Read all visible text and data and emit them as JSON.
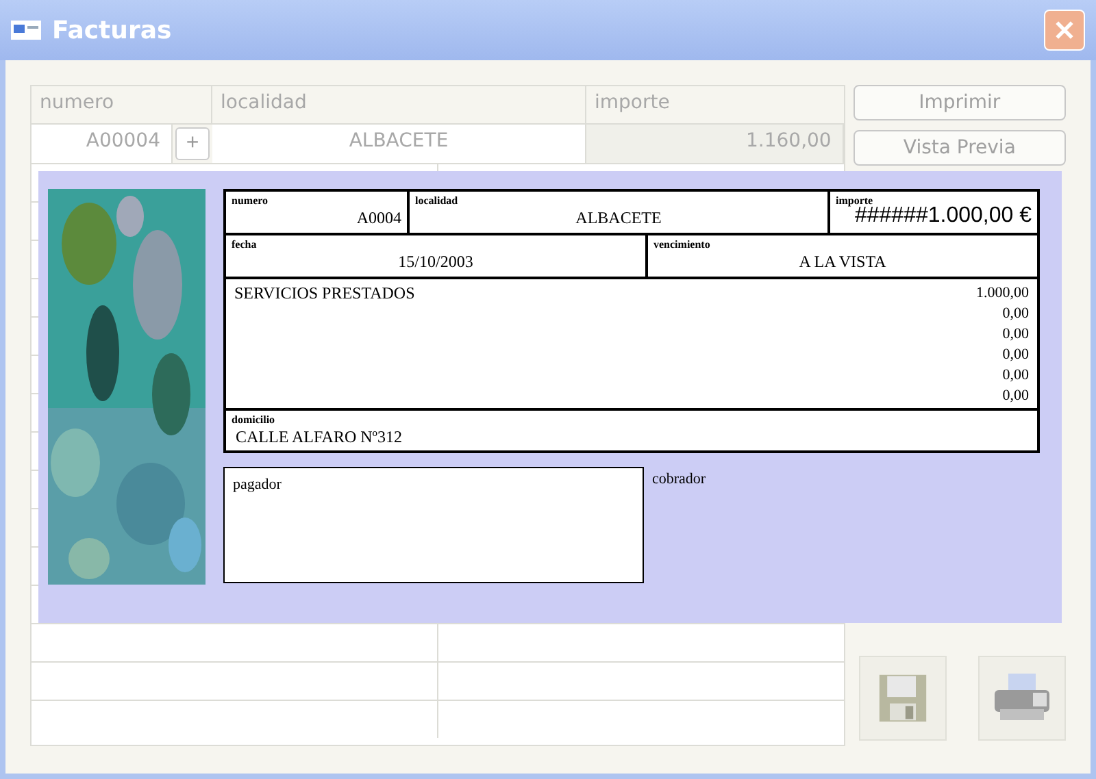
{
  "window": {
    "title": "Facturas"
  },
  "form": {
    "columns": [
      "numero",
      "localidad",
      "importe"
    ],
    "numero": "A00004",
    "add_button": "+",
    "localidad": "ALBACETE",
    "importe": "1.160,00"
  },
  "buttons": [
    "Imprimir",
    "Vista Previa"
  ],
  "preview": {
    "numero": {
      "label": "numero",
      "value": "A0004"
    },
    "localidad": {
      "label": "localidad",
      "value": "ALBACETE"
    },
    "importe": {
      "label": "importe",
      "value": "######1.000,00 €"
    },
    "fecha": {
      "label": "fecha",
      "value": "15/10/2003"
    },
    "vencimiento": {
      "label": "vencimiento",
      "value": "A LA VISTA"
    },
    "concepto": "SERVICIOS PRESTADOS",
    "amounts": [
      "1.000,00",
      "0,00",
      "0,00",
      "0,00",
      "0,00",
      "0,00"
    ],
    "domicilio": {
      "label": "domicilio",
      "value": "CALLE ALFARO Nº312"
    },
    "pagador": "pagador",
    "cobrador": "cobrador"
  }
}
